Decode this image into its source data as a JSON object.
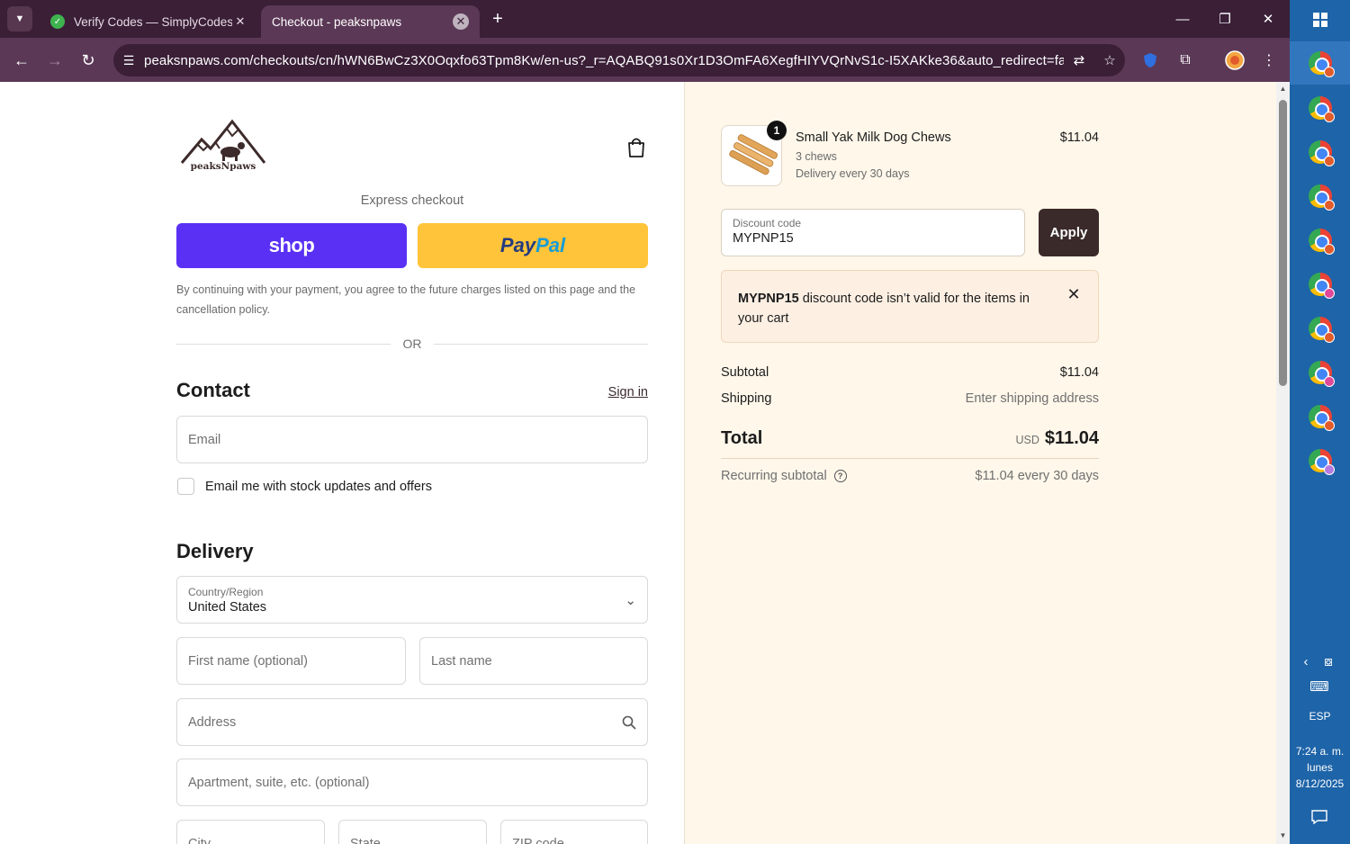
{
  "browser": {
    "tabs": [
      {
        "title": "Verify Codes — SimplyCodes",
        "active": false
      },
      {
        "title": "Checkout - peaksnpaws",
        "active": true
      }
    ],
    "url": "peaksnpaws.com/checkouts/cn/hWN6BwCz3X0Oqxfo63Tpm8Kw/en-us?_r=AQABQ91s0Xr1D3OmFA6XegfHIYVQrNvS1c-I5XAKke36&auto_redirect=false&e..."
  },
  "taskbar": {
    "language": "ESP",
    "time": "7:24 a. m.",
    "day": "lunes",
    "date": "8/12/2025"
  },
  "checkout": {
    "brand": "peaksNpaws",
    "express_label": "Express checkout",
    "shop_pay_label": "shop",
    "paypal_label_1": "Pay",
    "paypal_label_2": "Pal",
    "policy_text": "By continuing with your payment, you agree to the future charges listed on this page and the cancellation policy.",
    "or_label": "OR",
    "contact": {
      "title": "Contact",
      "sign_in": "Sign in",
      "email_placeholder": "Email",
      "newsletter_label": "Email me with stock updates and offers"
    },
    "delivery": {
      "title": "Delivery",
      "country_label": "Country/Region",
      "country_value": "United States",
      "first_name_placeholder": "First name (optional)",
      "last_name_placeholder": "Last name",
      "address_placeholder": "Address",
      "apartment_placeholder": "Apartment, suite, etc. (optional)",
      "city_placeholder": "City",
      "state_placeholder": "State",
      "zip_placeholder": "ZIP code"
    }
  },
  "summary": {
    "product": {
      "quantity": "1",
      "name": "Small Yak Milk Dog Chews",
      "variant": "3 chews",
      "delivery": "Delivery every 30 days",
      "price": "$11.04"
    },
    "discount": {
      "label": "Discount code",
      "value": "MYPNP15",
      "apply": "Apply"
    },
    "alert": {
      "code": "MYPNP15",
      "message": " discount code isn’t valid for the items in your cart"
    },
    "subtotal_label": "Subtotal",
    "subtotal_value": "$11.04",
    "shipping_label": "Shipping",
    "shipping_value": "Enter shipping address",
    "total_label": "Total",
    "total_currency": "USD",
    "total_value": "$11.04",
    "recurring_label": "Recurring subtotal",
    "recurring_value": "$11.04 every 30 days"
  },
  "colors": {
    "browser_frame": "#3a1f37",
    "toolbar": "#5b3856",
    "shop_pay": "#5a31f4",
    "paypal": "#ffc439",
    "apply_button": "#3b2a2a",
    "summary_bg": "#fef7ea",
    "taskbar": "#1e64a8"
  }
}
